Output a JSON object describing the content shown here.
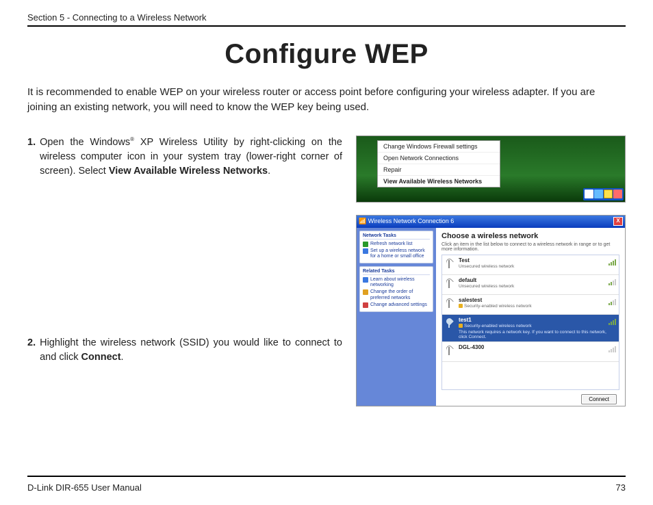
{
  "header": {
    "section": "Section 5 - Connecting to a Wireless Network"
  },
  "title": "Configure WEP",
  "intro": "It is recommended to enable WEP on your wireless router or access point before configuring your wireless adapter. If you are joining an existing network, you will need to know the WEP key being used.",
  "step1": {
    "num": "1.",
    "t1": "Open the Windows",
    "reg": "®",
    "t2": " XP Wireless Utility by right-clicking on the wireless computer icon in your system tray (lower-right corner of screen). Select ",
    "bold": "View Available Wireless Networks",
    "t3": "."
  },
  "step2": {
    "num": "2.",
    "t1": "Highlight the wireless network (SSID) you would like to connect to and click ",
    "bold": "Connect",
    "t2": "."
  },
  "contextmenu": {
    "i1": "Change Windows Firewall settings",
    "i2": "Open Network Connections",
    "i3": "Repair",
    "i4": "View Available Wireless Networks"
  },
  "wnc": {
    "title": "Wireless Network Connection 6",
    "close": "X",
    "tasks_hd": "Network Tasks",
    "refresh": "Refresh network list",
    "setup": "Set up a wireless network for a home or small office",
    "related_hd": "Related Tasks",
    "learn": "Learn about wireless networking",
    "change_order": "Change the order of preferred networks",
    "change_adv": "Change advanced settings",
    "main_hd": "Choose a wireless network",
    "main_sub": "Click an item in the list below to connect to a wireless network in range or to get more information.",
    "unsec": "Unsecured wireless network",
    "sec": "Security-enabled wireless network",
    "n1": "Test",
    "n2": "default",
    "n3": "salestest",
    "n4": "test1",
    "n4extra": "This network requires a network key. If you want to connect to this network, click Connect.",
    "n5": "DGL-4300",
    "connect": "Connect"
  },
  "footer": {
    "left": "D-Link DIR-655 User Manual",
    "right": "73"
  }
}
